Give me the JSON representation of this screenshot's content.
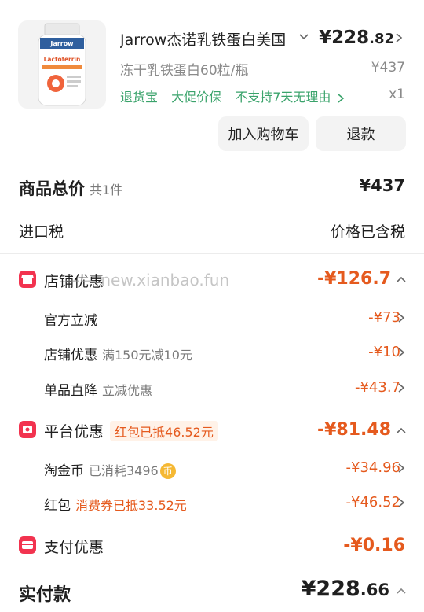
{
  "product": {
    "name": "Jarrow杰诺乳铁蛋白美国",
    "price_main": "¥228",
    "price_cents": ".82",
    "spec": "冻干乳铁蛋白60粒/瓶",
    "original_price": "¥437",
    "services": [
      "退货宝",
      "大促价保",
      "不支持7天无理由"
    ],
    "quantity": "x1",
    "image_brand": "Jarrow",
    "image_label": "Lactoferrin"
  },
  "actions": {
    "add_to_cart": "加入购物车",
    "refund": "退款"
  },
  "summary": {
    "total_label": "商品总价",
    "total_count": "共1件",
    "total_value": "¥437",
    "import_tax_label": "进口税",
    "import_tax_value": "价格已含税"
  },
  "store_discount": {
    "label": "店铺优惠",
    "value": "-¥126.7",
    "items": [
      {
        "label": "官方立减",
        "note": "",
        "value": "-¥73"
      },
      {
        "label": "店铺优惠",
        "note": "满150元减10元",
        "value": "-¥10"
      },
      {
        "label": "单品直降",
        "note": "立减优惠",
        "value": "-¥43.7"
      }
    ]
  },
  "platform_discount": {
    "label": "平台优惠",
    "badge": "红包已抵46.52元",
    "value": "-¥81.48",
    "items": [
      {
        "label": "淘金币",
        "note": "已消耗3496",
        "value": "-¥34.96",
        "coin": "币"
      },
      {
        "label": "红包",
        "note": "消费券已抵33.52元",
        "value": "-¥46.52"
      }
    ]
  },
  "payment_discount": {
    "label": "支付优惠",
    "value": "-¥0.16"
  },
  "paid": {
    "label": "实付款",
    "value_main": "¥228",
    "value_cents": ".66"
  },
  "watermark": "—— new.xianbao.fun",
  "colors": {
    "discount": "#e55a1e",
    "service_green": "#3aa36b",
    "section_icon": "#f2334f"
  }
}
